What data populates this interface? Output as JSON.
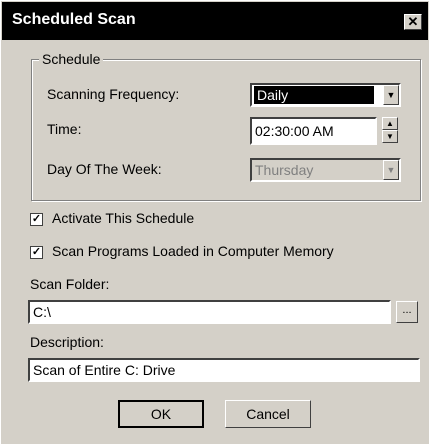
{
  "window": {
    "title": "Scheduled Scan",
    "close_glyph": "✕"
  },
  "schedule": {
    "group_label": "Schedule",
    "frequency_label": "Scanning Frequency:",
    "frequency_value": "Daily",
    "time_label": "Time:",
    "time_value": "02:30:00 AM",
    "day_label": "Day Of The Week:",
    "day_value": "Thursday"
  },
  "options": {
    "activate_label": "Activate This Schedule",
    "activate_checked": true,
    "scan_memory_label": "Scan Programs Loaded in Computer Memory",
    "scan_memory_checked": true
  },
  "folder": {
    "label": "Scan Folder:",
    "value": "C:\\",
    "browse_label": "..."
  },
  "description": {
    "label": "Description:",
    "value": "Scan of Entire C: Drive"
  },
  "buttons": {
    "ok": "OK",
    "cancel": "Cancel"
  },
  "icons": {
    "dropdown": "chevron-down-icon",
    "spin_up": "arrow-up-icon",
    "spin_down": "arrow-down-icon"
  }
}
